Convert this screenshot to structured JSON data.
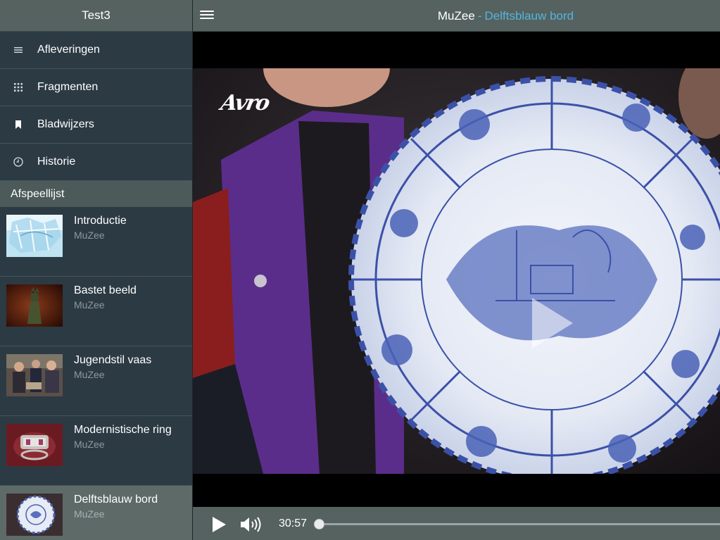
{
  "sidebar": {
    "title": "Test3",
    "nav": [
      {
        "label": "Afleveringen",
        "icon": "list-icon"
      },
      {
        "label": "Fragmenten",
        "icon": "grid-icon"
      },
      {
        "label": "Bladwijzers",
        "icon": "bookmark-icon"
      },
      {
        "label": "Historie",
        "icon": "clock-icon"
      }
    ],
    "playlist_header": "Afspeellijst",
    "playlist": [
      {
        "title": "Introductie",
        "subtitle": "MuZee",
        "active": false
      },
      {
        "title": "Bastet beeld",
        "subtitle": "MuZee",
        "active": false
      },
      {
        "title": "Jugendstil vaas",
        "subtitle": "MuZee",
        "active": false
      },
      {
        "title": "Modernistische ring",
        "subtitle": "MuZee",
        "active": false
      },
      {
        "title": "Delftsblauw bord",
        "subtitle": "MuZee",
        "active": true
      }
    ]
  },
  "header": {
    "app_name": "MuZee",
    "separator": "-",
    "current_item": "Delftsblauw bord"
  },
  "player": {
    "broadcaster_logo": "Avro",
    "time": "30:57",
    "progress": 0.0
  },
  "colors": {
    "accent": "#56b3e0",
    "sidebar_bg": "#2c3a43",
    "bar_bg": "#55625f",
    "active_row": "#5d6a68"
  }
}
